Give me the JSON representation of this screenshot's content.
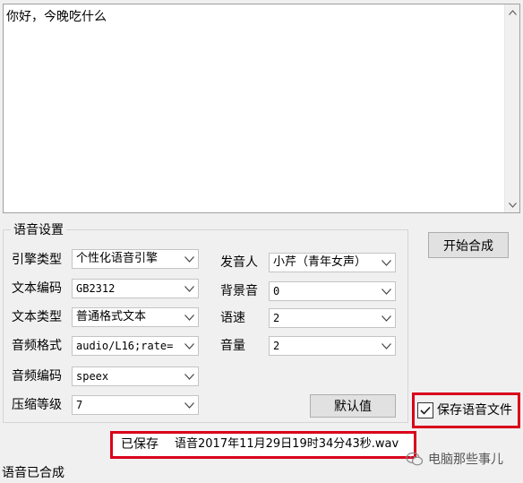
{
  "main_text": {
    "value": "你好，今晚吃什么"
  },
  "group": {
    "title": "语音设置"
  },
  "settings": {
    "engine_type": {
      "label": "引擎类型",
      "value": "个性化语音引擎"
    },
    "text_encoding": {
      "label": "文本编码",
      "value": "GB2312"
    },
    "text_type": {
      "label": "文本类型",
      "value": "普通格式文本"
    },
    "audio_format": {
      "label": "音频格式",
      "value": "audio/L16;rate="
    },
    "audio_codec": {
      "label": "音频编码",
      "value": "speex"
    },
    "compress_level": {
      "label": "压缩等级",
      "value": "7"
    },
    "speaker": {
      "label": "发音人",
      "value": "小芹（青年女声）"
    },
    "background_sound": {
      "label": "背景音",
      "value": "0"
    },
    "speed": {
      "label": "语速",
      "value": "2"
    },
    "volume": {
      "label": "音量",
      "value": "2"
    }
  },
  "buttons": {
    "default_label": "默认值",
    "start_label": "开始合成"
  },
  "save_file": {
    "label": "保存语音文件",
    "checked": true
  },
  "saved": {
    "prefix": "已保存",
    "filename": "语音2017年11月29日19时34分43秒.wav"
  },
  "status": {
    "text": "语音已合成"
  },
  "watermark": {
    "text": "电脑那些事儿"
  },
  "colors": {
    "highlight": "#d9001b",
    "window_bg": "#f0f0f0"
  }
}
